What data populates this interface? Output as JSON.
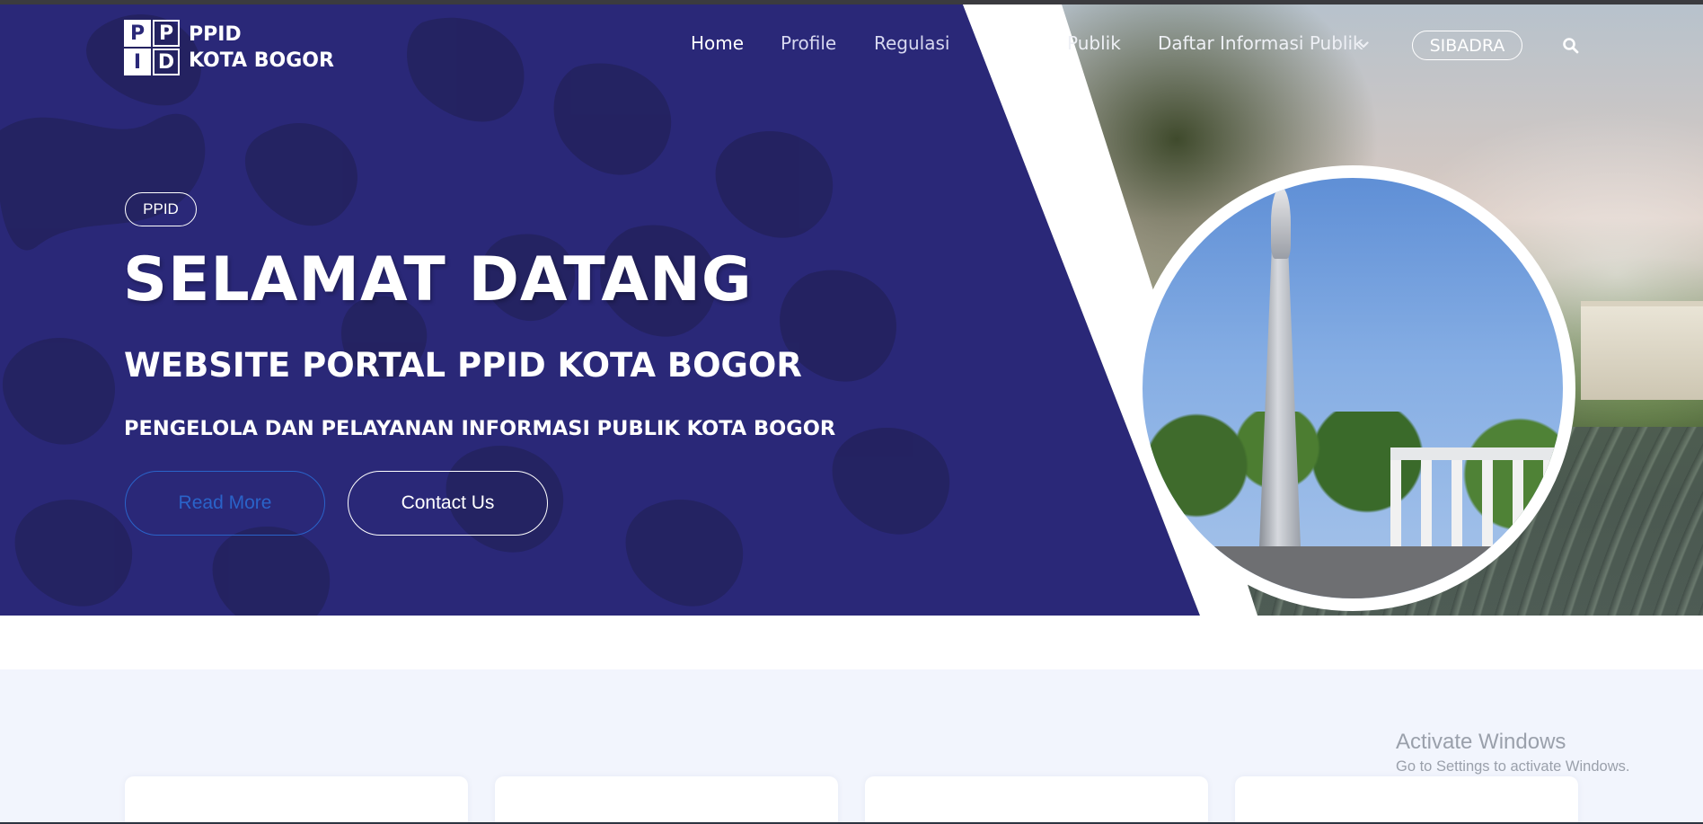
{
  "brand": {
    "logo_letters": [
      "P",
      "P",
      "I",
      "D"
    ],
    "line1": "PPID",
    "line2": "KOTA BOGOR",
    "color_primary": "#2a2878"
  },
  "nav": {
    "home": "Home",
    "profile": "Profile",
    "regulasi": "Regulasi",
    "publik": "Publik",
    "daftar": "Daftar Informasi Publik",
    "sibadra": "SIBADRA",
    "search_icon": "search-icon",
    "dropdown_icon": "chevron-down-icon"
  },
  "hero": {
    "badge": "PPID",
    "title": "SELAMAT DATANG",
    "subtitle": "WEBSITE PORTAL PPID KOTA BOGOR",
    "tagline": "PENGELOLA DAN PELAYANAN INFORMASI PUBLIK KOTA BOGOR",
    "read_more": "Read More",
    "contact_us": "Contact Us",
    "read_more_color": "#2a63c9"
  },
  "section2": {
    "background": "#f2f5fd",
    "card_count": 4
  },
  "watermark": {
    "line1": "Activate Windows",
    "line2": "Go to Settings to activate Windows."
  }
}
